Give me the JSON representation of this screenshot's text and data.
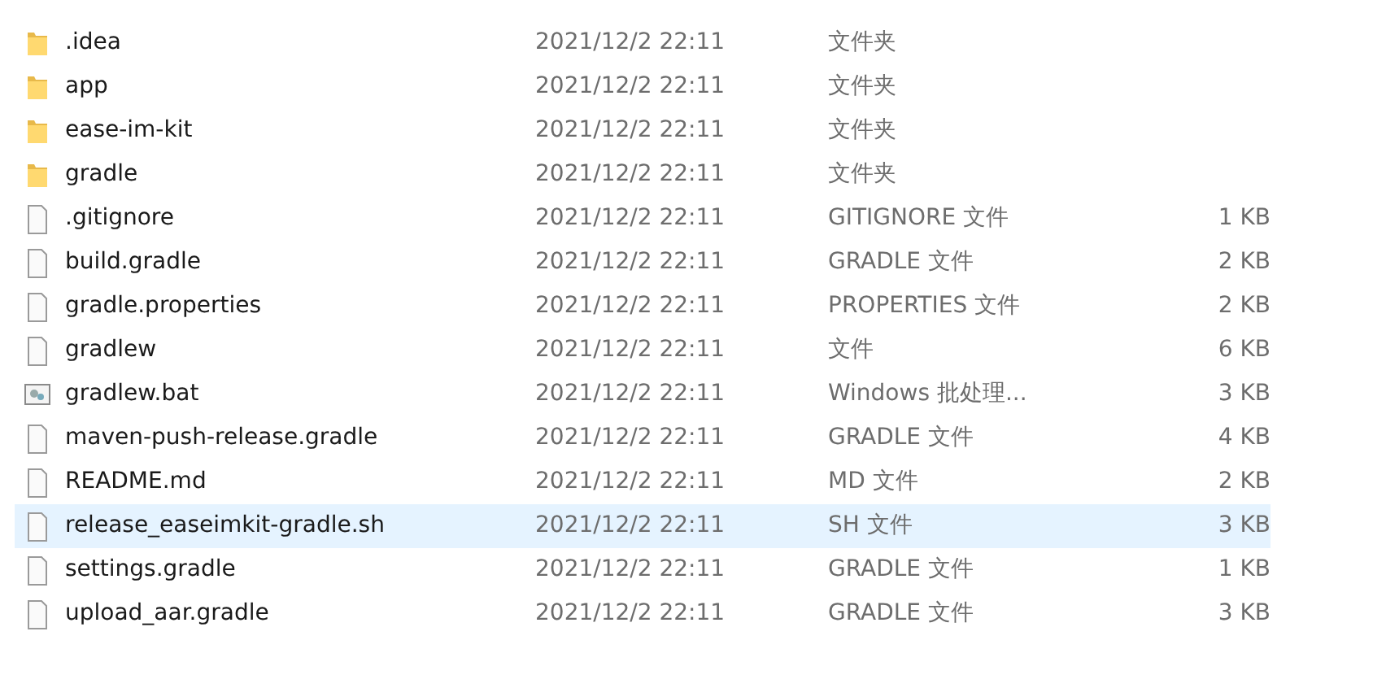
{
  "files": [
    {
      "kind": "folder",
      "name": ".idea",
      "modified": "2021/12/2 22:11",
      "type": "文件夹",
      "selected": false
    },
    {
      "kind": "folder",
      "name": "app",
      "modified": "2021/12/2 22:11",
      "type": "文件夹",
      "selected": false
    },
    {
      "kind": "folder",
      "name": "ease-im-kit",
      "modified": "2021/12/2 22:11",
      "type": "文件夹",
      "selected": false
    },
    {
      "kind": "folder",
      "name": "gradle",
      "modified": "2021/12/2 22:11",
      "type": "文件夹",
      "selected": false
    },
    {
      "kind": "file",
      "name": ".gitignore",
      "modified": "2021/12/2 22:11",
      "type": "GITIGNORE 文件",
      "size": "1 KB",
      "selected": false
    },
    {
      "kind": "file",
      "name": "build.gradle",
      "modified": "2021/12/2 22:11",
      "type": "GRADLE 文件",
      "size": "2 KB",
      "selected": false
    },
    {
      "kind": "file",
      "name": "gradle.properties",
      "modified": "2021/12/2 22:11",
      "type": "PROPERTIES 文件",
      "size": "2 KB",
      "selected": false
    },
    {
      "kind": "file",
      "name": "gradlew",
      "modified": "2021/12/2 22:11",
      "type": "文件",
      "size": "6 KB",
      "selected": false
    },
    {
      "kind": "batch",
      "name": "gradlew.bat",
      "modified": "2021/12/2 22:11",
      "type": "Windows 批处理...",
      "size": "3 KB",
      "selected": false
    },
    {
      "kind": "file",
      "name": "maven-push-release.gradle",
      "modified": "2021/12/2 22:11",
      "type": "GRADLE 文件",
      "size": "4 KB",
      "selected": false
    },
    {
      "kind": "file",
      "name": "README.md",
      "modified": "2021/12/2 22:11",
      "type": "MD 文件",
      "size": "2 KB",
      "selected": false
    },
    {
      "kind": "file",
      "name": "release_easeimkit-gradle.sh",
      "modified": "2021/12/2 22:11",
      "type": "SH 文件",
      "size": "3 KB",
      "selected": true
    },
    {
      "kind": "file",
      "name": "settings.gradle",
      "modified": "2021/12/2 22:11",
      "type": "GRADLE 文件",
      "size": "1 KB",
      "selected": false
    },
    {
      "kind": "file",
      "name": "upload_aar.gradle",
      "modified": "2021/12/2 22:11",
      "type": "GRADLE 文件",
      "size": "3 KB",
      "selected": false
    }
  ]
}
